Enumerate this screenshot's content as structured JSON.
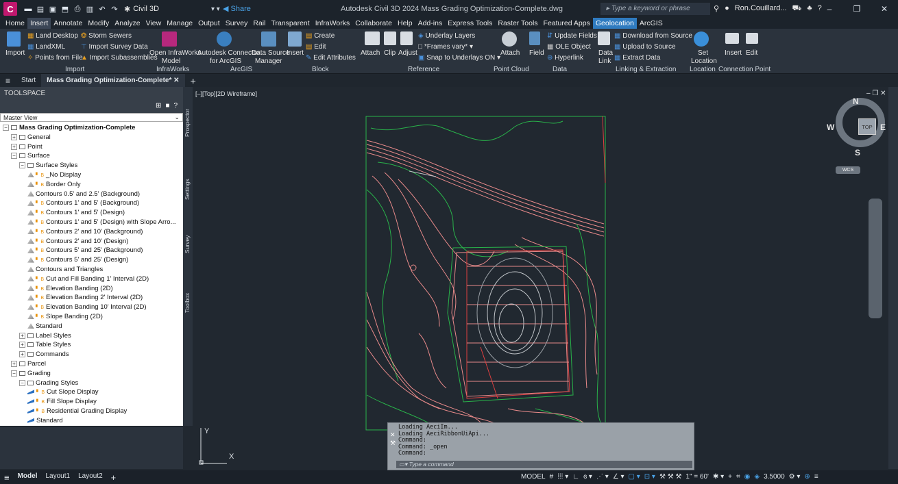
{
  "app": {
    "logo": "C",
    "workspace": "Civil 3D",
    "share_label": "Share",
    "title": "Autodesk Civil 3D 2024   Mass Grading Optimization-Complete.dwg",
    "search_placeholder": "Type a keyword or phrase",
    "user": "Ron.Couillard...",
    "accent": "#c0186e"
  },
  "menu": [
    "Home",
    "Insert",
    "Annotate",
    "Modify",
    "Analyze",
    "View",
    "Manage",
    "Output",
    "Survey",
    "Rail",
    "Transparent",
    "InfraWorks",
    "Collaborate",
    "Help",
    "Add-ins",
    "Express Tools",
    "Raster Tools",
    "Featured Apps",
    "Geolocation",
    "ArcGIS"
  ],
  "menu_active": "Insert",
  "ribbon": {
    "import_label": "Import",
    "land_desktop": "Land Desktop",
    "landxml": "LandXML",
    "points_from_file": "Points from File",
    "storm_sewers": "Storm Sewers",
    "import_survey": "Import Survey Data",
    "import_subassemblies": "Import Subassemblies",
    "open_infraworks": "Open InfraWorks",
    "model": "Model",
    "autodesk_connector": "Autodesk Connector",
    "for_arcgis": "for ArcGIS",
    "data_source": "Data Source",
    "manager": "Manager",
    "insert": "Insert",
    "create": "Create",
    "edit": "Edit",
    "edit_attributes": "Edit Attributes",
    "attach": "Attach",
    "clip": "Clip",
    "adjust": "Adjust",
    "underlay_layers": "Underlay Layers",
    "frames_vary": "*Frames vary*",
    "snap_underlays": "Snap to Underlays ON",
    "attach2": "Attach",
    "field": "Field",
    "update_fields": "Update Fields",
    "ole_object": "OLE Object",
    "hyperlink": "Hyperlink",
    "data_link": "Data",
    "link": "Link",
    "download_source": "Download from Source",
    "upload_source": "Upload to Source",
    "extract_data": "Extract  Data",
    "set": "Set",
    "location": "Location",
    "insert2": "Insert",
    "edit2": "Edit",
    "panels": [
      "Import",
      "InfraWorks",
      "ArcGIS",
      "Block",
      "Reference",
      "Point Cloud",
      "Data",
      "Linking & Extraction",
      "Location",
      "Connection Point"
    ]
  },
  "tabs": {
    "start": "Start",
    "doc": "Mass Grading Optimization-Complete*"
  },
  "toolspace": {
    "title": "TOOLSPACE",
    "view": "Master View",
    "side_tabs": [
      "Prospector",
      "Settings",
      "Survey",
      "Toolbox"
    ],
    "tree": [
      {
        "label": "Mass Grading Optimization-Complete",
        "level": 0,
        "bold": true
      },
      {
        "label": "General",
        "level": 1
      },
      {
        "label": "Point",
        "level": 1
      },
      {
        "label": "Surface",
        "level": 1
      },
      {
        "label": "Surface Styles",
        "level": 2
      },
      {
        "label": "_No Display",
        "level": 3,
        "style": true
      },
      {
        "label": "Border Only",
        "level": 3,
        "style": true
      },
      {
        "label": "Contours 0.5' and 2.5' (Background)",
        "level": 3
      },
      {
        "label": "Contours 1' and 5' (Background)",
        "level": 3,
        "style": true
      },
      {
        "label": "Contours 1' and 5' (Design)",
        "level": 3,
        "style": true
      },
      {
        "label": "Contours 1' and 5' (Design) with Slope Arro...",
        "level": 3,
        "style": true
      },
      {
        "label": "Contours 2' and 10' (Background)",
        "level": 3,
        "style": true
      },
      {
        "label": "Contours 2' and 10' (Design)",
        "level": 3,
        "style": true
      },
      {
        "label": "Contours 5' and 25' (Background)",
        "level": 3,
        "style": true
      },
      {
        "label": "Contours 5' and 25' (Design)",
        "level": 3,
        "style": true
      },
      {
        "label": "Contours and Triangles",
        "level": 3
      },
      {
        "label": "Cut and Fill Banding 1' Interval (2D)",
        "level": 3,
        "style": true
      },
      {
        "label": "Elevation Banding (2D)",
        "level": 3,
        "style": true
      },
      {
        "label": "Elevation Banding 2' Interval (2D)",
        "level": 3,
        "style": true
      },
      {
        "label": "Elevation Banding 10' Interval (2D)",
        "level": 3,
        "style": true
      },
      {
        "label": "Slope Banding (2D)",
        "level": 3,
        "style": true
      },
      {
        "label": "Standard",
        "level": 3
      },
      {
        "label": "Label Styles",
        "level": 2
      },
      {
        "label": "Table Styles",
        "level": 2
      },
      {
        "label": "Commands",
        "level": 2
      },
      {
        "label": "Parcel",
        "level": 1
      },
      {
        "label": "Grading",
        "level": 1
      },
      {
        "label": "Grading Styles",
        "level": 2
      },
      {
        "label": "Cut Slope Display",
        "level": 3,
        "style": true,
        "grading": true
      },
      {
        "label": "Fill Slope Display",
        "level": 3,
        "style": true,
        "grading": true
      },
      {
        "label": "Residential Grading Display",
        "level": 3,
        "style": true,
        "grading": true
      },
      {
        "label": "Standard",
        "level": 3,
        "grading": true
      }
    ]
  },
  "viewport": {
    "label": "[–][Top][2D Wireframe]",
    "wcs": "WCS",
    "ucs_x": "X",
    "ucs_y": "Y",
    "top": "TOP",
    "compass": {
      "n": "N",
      "s": "S",
      "e": "E",
      "w": "W"
    }
  },
  "command": {
    "history": [
      "Loading AeciIm...",
      "Loading AeciRibbonUiApi...",
      "Command:",
      "Command: _open",
      "Command:"
    ],
    "placeholder": "Type a command"
  },
  "status": {
    "layouts": [
      "Model",
      "Layout1",
      "Layout2"
    ],
    "model": "MODEL",
    "scale": "1\" = 60'",
    "lineweight": "3.5000"
  }
}
